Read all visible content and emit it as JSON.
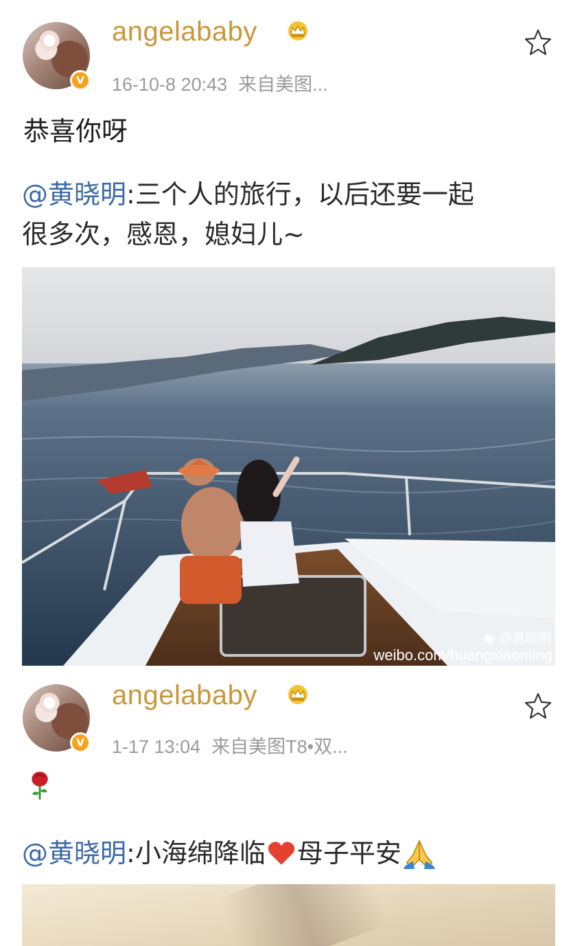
{
  "posts": [
    {
      "username": "angelababy",
      "verified_badge": "V",
      "timestamp": "16-10-8 20:43",
      "source": "来自美图...",
      "text": "恭喜你呀",
      "repost": {
        "mention": "@黄晓明",
        "line1_rest": ":三个人的旅行，以后还要一起",
        "line2": "很多次，感恩，媳妇儿~"
      },
      "photo": {
        "watermark_handle": "@黄晓明",
        "watermark_url": "weibo.com/huangxiaoming"
      }
    },
    {
      "username": "angelababy",
      "verified_badge": "V",
      "timestamp": "1-17 13:04",
      "source": "来自美图T8•双...",
      "text_emoji": "rose",
      "repost": {
        "mention": "@黄晓明",
        "text_part1": ":小海绵降临",
        "emoji_heart": "red-heart",
        "text_part2": "母子平安",
        "emoji_hands": "folded-hands"
      }
    }
  ],
  "icons": {
    "crown": "crown-icon",
    "star": "star-outline-icon"
  },
  "colors": {
    "username": "#c9973a",
    "mention": "#3c6aa6",
    "meta": "#9a9a9a",
    "badge": "#f7a21b"
  }
}
